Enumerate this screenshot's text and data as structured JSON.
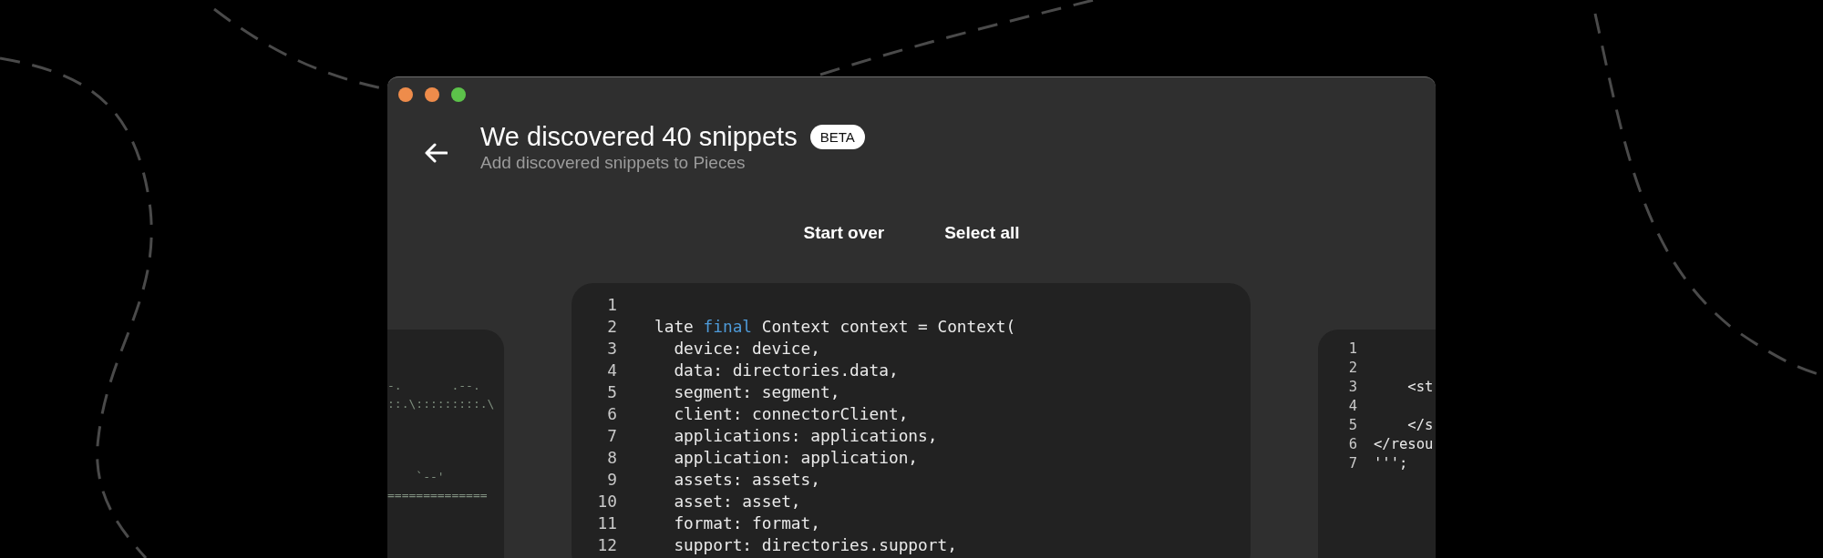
{
  "window": {
    "traffic_lights": [
      {
        "color": "#ee8c4b"
      },
      {
        "color": "#ee8c4b"
      },
      {
        "color": "#5cc24a"
      }
    ]
  },
  "header": {
    "title": "We discovered 40 snippets",
    "badge": "BETA",
    "subtitle": "Add discovered snippets to Pieces"
  },
  "actions": [
    "Start over",
    "Select all"
  ],
  "previous_snippet": {
    "lines": [
      {
        "code": "-.       .--."
      },
      {
        "code": "::.\\:::::::::.\\"
      },
      {
        "code": "    `--'"
      },
      {
        "code": "=============="
      }
    ]
  },
  "current_snippet": {
    "lines": [
      {
        "number": "1"
      },
      {
        "number": "2",
        "tokens": [
          {
            "text": "late ",
            "kind": "plain"
          },
          {
            "text": "final",
            "kind": "keyword"
          },
          {
            "text": " Context context = Context(",
            "kind": "plain"
          }
        ]
      },
      {
        "number": "3",
        "code": "  device: device,"
      },
      {
        "number": "4",
        "code": "  data: directories.data,"
      },
      {
        "number": "5",
        "code": "  segment: segment,"
      },
      {
        "number": "6",
        "code": "  client: connectorClient,"
      },
      {
        "number": "7",
        "code": "  applications: applications,"
      },
      {
        "number": "8",
        "code": "  application: application,"
      },
      {
        "number": "9",
        "code": "  assets: assets,"
      },
      {
        "number": "10",
        "code": "  asset: asset,"
      },
      {
        "number": "11",
        "code": "  format: format,"
      },
      {
        "number": "12",
        "code": "  support: directories.support,"
      }
    ]
  },
  "next_snippet": {
    "lines": [
      {
        "number": "1"
      },
      {
        "number": "2"
      },
      {
        "number": "3",
        "code": "    <st"
      },
      {
        "number": "4"
      },
      {
        "number": "5",
        "code": "    </s"
      },
      {
        "number": "6",
        "code": "</resou"
      },
      {
        "number": "7",
        "code": "''';"
      }
    ]
  }
}
